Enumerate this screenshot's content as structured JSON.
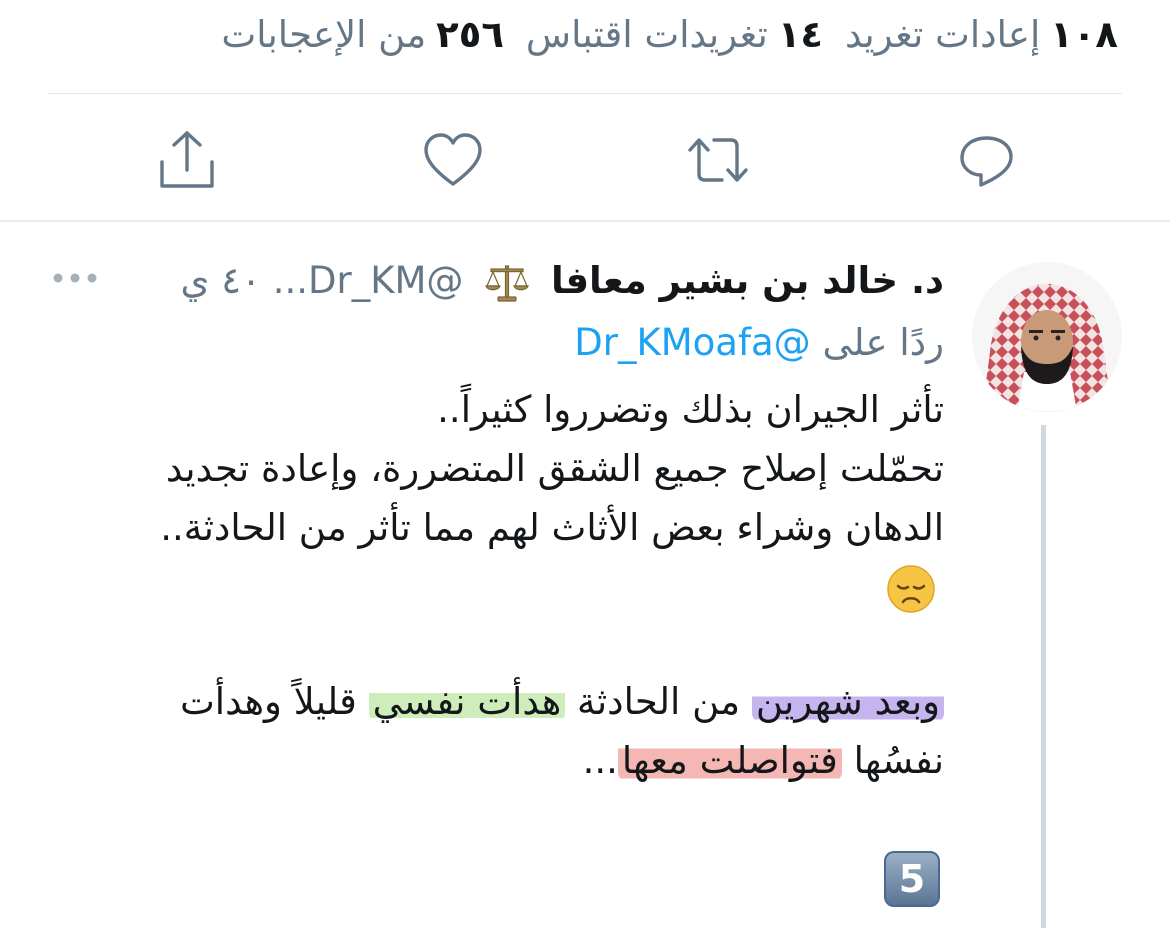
{
  "stats": {
    "retweets_count": "١٠٨",
    "retweets_label": "إعادات تغريد",
    "quotes_count": "١٤",
    "quotes_label": "تغريدات اقتباس",
    "likes_count": "٢٥٦",
    "likes_label": "من الإعجابات"
  },
  "actions": {
    "reply_icon": "reply-icon",
    "retweet_icon": "retweet-icon",
    "like_icon": "heart-icon",
    "share_icon": "share-icon"
  },
  "reply_tweet": {
    "display_name": "د. خالد بن بشير معافا",
    "badge_icon": "scale-icon",
    "handle": "@Dr_KM...",
    "time": "٤٠ ي",
    "reply_prefix": "ردًا على",
    "reply_handle": "@Dr_KMoafa",
    "body": {
      "p1_line1": "تأثر الجيران بذلك وتضرروا كثيراً..",
      "p1_line2": "تحمّلت إصلاح جميع الشقق المتضررة، وإعادة تجديد الدهان وشراء بعض الأثاث لهم مما تأثر من الحادثة..",
      "p2_highlight_purple": "وبعد شهرين",
      "p2_plain1": "من الحادثة",
      "p2_highlight_green": "هدأت نفسي",
      "p2_plain2": "قليلاً وهدأت نفسُها",
      "p2_highlight_red": "فتواصلت معها",
      "p2_tail": "..."
    },
    "thread_number": "5"
  },
  "colors": {
    "accent_blue": "#1da1f2",
    "secondary_text": "#657786",
    "icon_gray": "#657786"
  }
}
